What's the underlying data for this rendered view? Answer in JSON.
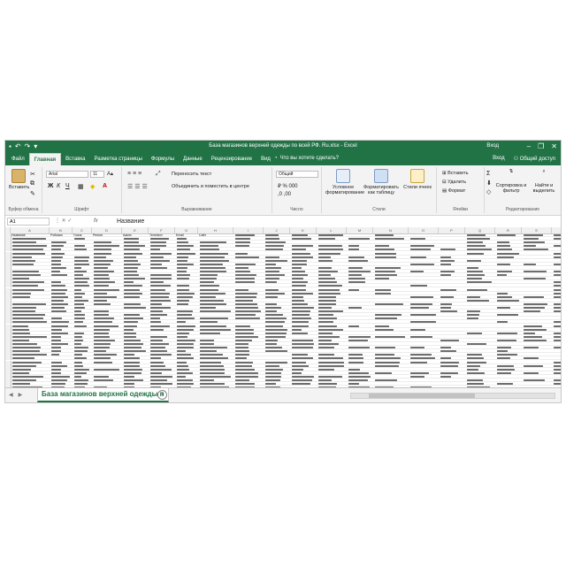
{
  "window": {
    "title": "База магазинов верхней одежды по всей РФ. Ru.xlsx - Excel",
    "signin": "Вход",
    "minimize": "–",
    "restore": "❐",
    "close": "✕"
  },
  "ribbon_tabs": [
    "Файл",
    "Главная",
    "Вставка",
    "Разметка страницы",
    "Формулы",
    "Данные",
    "Рецензирование",
    "Вид"
  ],
  "active_tab": "Главная",
  "tell_me": "Что вы хотите сделать?",
  "share": "Общий доступ",
  "clipboard": {
    "paste": "Вставить",
    "label": "Буфер обмена"
  },
  "font": {
    "name": "Arial",
    "size": "11",
    "bold": "Ж",
    "italic": "К",
    "underline": "Ч",
    "label": "Шрифт"
  },
  "alignment": {
    "wrap": "Переносить текст",
    "merge": "Объединить и поместить в центре",
    "label": "Выравнивание"
  },
  "number": {
    "format": "Общий",
    "label": "Число"
  },
  "styles": {
    "conditional": "Условное форматирование",
    "table": "Форматировать как таблицу",
    "cell": "Стили ячеек",
    "label": "Стили"
  },
  "cells": {
    "insert": "Вставить",
    "delete": "Удалить",
    "format": "Формат",
    "label": "Ячейки"
  },
  "editing": {
    "sort": "Сортировка и фильтр",
    "find": "Найти и выделить",
    "label": "Редактирование"
  },
  "namebox": "A1",
  "formula": "Название",
  "fx": "fx",
  "columns": [
    "A",
    "B",
    "C",
    "D",
    "E",
    "F",
    "G",
    "H",
    "I",
    "J",
    "K",
    "L",
    "M",
    "N",
    "O",
    "P",
    "Q",
    "R",
    "S",
    "T"
  ],
  "header_row": [
    "Название",
    "Рубрика",
    "Город",
    "Регион",
    "Адрес",
    "Телефон",
    "Email",
    "Сайт"
  ],
  "sheet_tab": "База магазинов верхней одежды п",
  "add_sheet": "+",
  "colors": {
    "accent": "#217346",
    "grid": "#ececec"
  }
}
